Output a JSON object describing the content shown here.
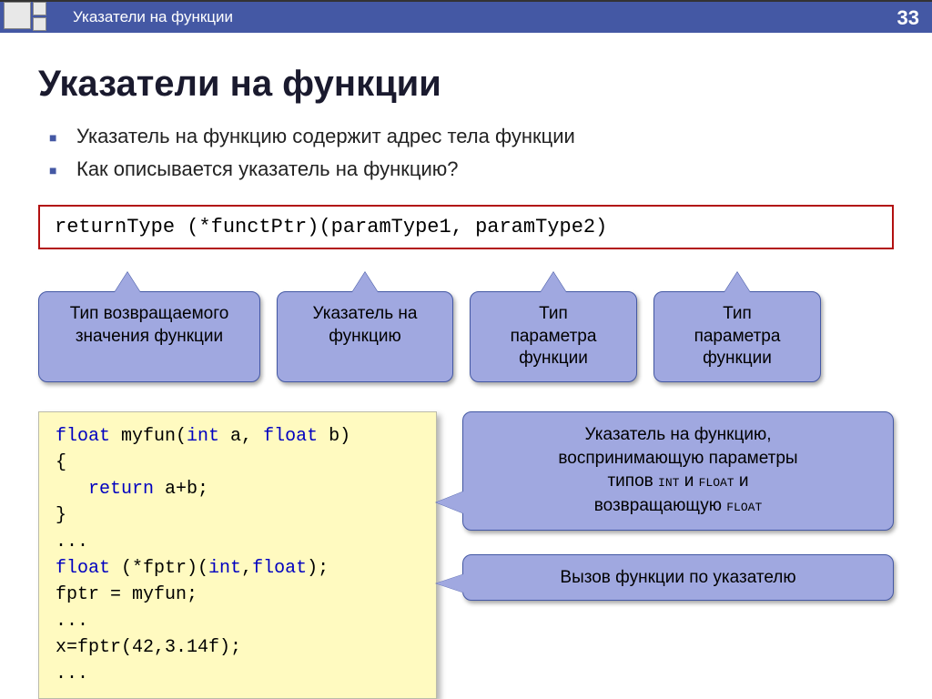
{
  "page_number": "33",
  "header_title": "Указатели на функции",
  "slide_title": "Указатели на функции",
  "bullets": [
    "Указатель на функцию содержит адрес тела функции",
    "Как описывается указатель на функцию?"
  ],
  "syntax": "returnType  (*functPtr)(paramType1, paramType2)",
  "callouts": {
    "c1": "Тип возвращаемого значения функции",
    "c2": "Указатель на функцию",
    "c3_line1": "Тип",
    "c3_line2": "параметра",
    "c3_line3": "функции",
    "c4_line1": "Тип",
    "c4_line2": "параметра",
    "c4_line3": "функции"
  },
  "code": {
    "l1a": "float",
    "l1b": " myfun(",
    "l1c": "int",
    "l1d": " a, ",
    "l1e": "float",
    "l1f": " b)",
    "l2": "{",
    "l3a": "   return",
    "l3b": " a+b;",
    "l4": "}",
    "l5": "...",
    "l6a": "float",
    "l6b": " (*fptr)(",
    "l6c": "int",
    "l6d": ",",
    "l6e": "float",
    "l6f": ");",
    "l7": "fptr = myfun;",
    "l8": "...",
    "l9": "x=fptr(42,3.14f);",
    "l10": "..."
  },
  "right": {
    "r1_l1": "Указатель на функцию,",
    "r1_l2": "воспринимающую параметры",
    "r1_l3a": "типов ",
    "r1_l3b": "int",
    "r1_l3c": " и ",
    "r1_l3d": "float",
    "r1_l3e": " и",
    "r1_l4a": "возвращающую ",
    "r1_l4b": "float",
    "r2": "Вызов функции по указателю"
  }
}
